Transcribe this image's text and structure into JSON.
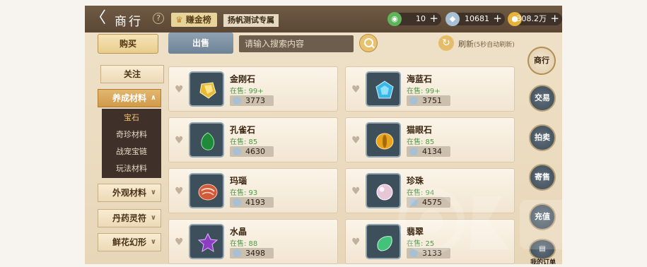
{
  "header": {
    "back_glyph": "〈",
    "title": "商行",
    "help": "?",
    "earn_label": "赚金榜",
    "subtitle": "扬帆测试专属",
    "currencies": [
      {
        "icon": "jade-coin-icon",
        "value": "10",
        "plus": "+"
      },
      {
        "icon": "silver-ingot-icon",
        "value": "10681",
        "plus": "+"
      },
      {
        "icon": "gold-coin-icon",
        "value": "308.2万",
        "plus": "+"
      }
    ]
  },
  "tabs": {
    "buy": "购买",
    "sell": "出售"
  },
  "search": {
    "placeholder": "请输入搜索内容"
  },
  "refresh": {
    "label": "刷新",
    "note": "(5秒自动刷新)"
  },
  "left_nav": {
    "follow": "关注",
    "cultivation": "养成材料",
    "sub_items": [
      "宝石",
      "奇珍材料",
      "战宠宝链",
      "玩法材料"
    ],
    "appearance": "外观材料",
    "elixir": "丹药灵符",
    "flower": "鲜花幻形"
  },
  "items": [
    {
      "name": "金刚石",
      "stock": "在售: 99+",
      "price": "3773",
      "color": "#e8b934"
    },
    {
      "name": "海蓝石",
      "stock": "在售: 99+",
      "price": "3751",
      "color": "#39b7e6"
    },
    {
      "name": "孔雀石",
      "stock": "在售: 85",
      "price": "4630",
      "color": "#1f8a3a"
    },
    {
      "name": "猫眼石",
      "stock": "在售: 85",
      "price": "4134",
      "color": "#e8a31f"
    },
    {
      "name": "玛瑙",
      "stock": "在售: 93",
      "price": "4193",
      "color": "#d25a3a"
    },
    {
      "name": "珍珠",
      "stock": "在售: 94",
      "price": "4575",
      "color": "#e7c6d8"
    },
    {
      "name": "水晶",
      "stock": "在售: 88",
      "price": "3498",
      "color": "#8a3fc2"
    },
    {
      "name": "翡翠",
      "stock": "在售: 25",
      "price": "3133",
      "color": "#43c27a"
    }
  ],
  "right_nav": {
    "shop": "商行",
    "trade": "交易",
    "auction": "拍卖",
    "consign": "寄售",
    "recharge": "充值",
    "orders": "我的订单"
  }
}
